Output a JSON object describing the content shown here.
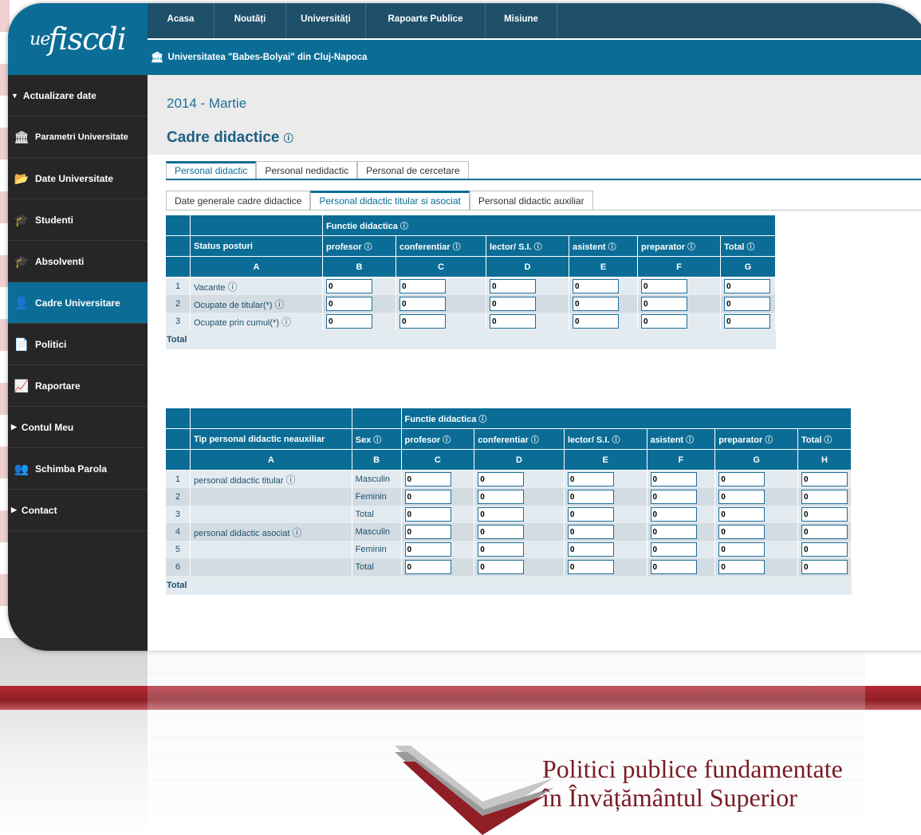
{
  "app": {
    "logo_text": "uefiscdi"
  },
  "top_menu": [
    "Acasa",
    "Noutăți",
    "Universități",
    "Rapoarte Publice",
    "Misiune"
  ],
  "university": "Universitatea \"Babes-Bolyai\" din Cluj-Napoca",
  "sidebar": {
    "items": [
      {
        "label": "Actualizare date",
        "icon": "triangle-down-icon"
      },
      {
        "label": "Parametri Universitate",
        "icon": "institution-icon"
      },
      {
        "label": "Date Universitate",
        "icon": "folder-icon"
      },
      {
        "label": "Studenti",
        "icon": "students-icon"
      },
      {
        "label": "Absolventi",
        "icon": "graduation-cap-icon"
      },
      {
        "label": "Cadre Universitare",
        "icon": "teacher-icon"
      },
      {
        "label": "Politici",
        "icon": "document-icon"
      },
      {
        "label": "Raportare",
        "icon": "chart-icon"
      },
      {
        "label": "Contul Meu",
        "icon": "triangle-right-icon"
      },
      {
        "label": "Schimba Parola",
        "icon": "user-key-icon"
      },
      {
        "label": "Contact",
        "icon": "triangle-right-icon"
      }
    ]
  },
  "period": "2014 - Martie",
  "page_title": "Cadre didactice",
  "tabs_primary": [
    "Personal didactic",
    "Personal nedidactic",
    "Personal de cercetare"
  ],
  "tabs_secondary": [
    "Date generale cadre didactice",
    "Personal didactic titular si asociat",
    "Personal didactic auxiliar"
  ],
  "table1": {
    "group_header": "Functie didactica",
    "row_header": "Status posturi",
    "columns": [
      "profesor",
      "conferentiar",
      "lector/ S.I.",
      "asistent",
      "preparator",
      "Total"
    ],
    "letters": [
      "A",
      "B",
      "C",
      "D",
      "E",
      "F",
      "G"
    ],
    "rows": [
      {
        "num": "1",
        "label": "Vacante",
        "values": [
          "0",
          "0",
          "0",
          "0",
          "0",
          "0"
        ]
      },
      {
        "num": "2",
        "label": "Ocupate de titular(*)",
        "values": [
          "0",
          "0",
          "0",
          "0",
          "0",
          "0"
        ]
      },
      {
        "num": "3",
        "label": "Ocupate prin cumul(*)",
        "values": [
          "0",
          "0",
          "0",
          "0",
          "0",
          "0"
        ]
      }
    ],
    "total_label": "Total"
  },
  "table2": {
    "group_header": "Functie didactica",
    "row_header": "Tip personal didactic neauxiliar",
    "sex_header": "Sex",
    "columns": [
      "profesor",
      "conferentiar",
      "lector/ S.I.",
      "asistent",
      "preparator",
      "Total"
    ],
    "letters": [
      "A",
      "B",
      "C",
      "D",
      "E",
      "F",
      "G",
      "H"
    ],
    "rows": [
      {
        "num": "1",
        "label": "personal didactic titular",
        "sex": "Masculin",
        "values": [
          "0",
          "0",
          "0",
          "0",
          "0",
          "0"
        ]
      },
      {
        "num": "2",
        "label": "",
        "sex": "Feminin",
        "values": [
          "0",
          "0",
          "0",
          "0",
          "0",
          "0"
        ]
      },
      {
        "num": "3",
        "label": "",
        "sex": "Total",
        "values": [
          "0",
          "0",
          "0",
          "0",
          "0",
          "0"
        ]
      },
      {
        "num": "4",
        "label": "personal didactic asociat",
        "sex": "Masculin",
        "values": [
          "0",
          "0",
          "0",
          "0",
          "0",
          "0"
        ]
      },
      {
        "num": "5",
        "label": "",
        "sex": "Feminin",
        "values": [
          "0",
          "0",
          "0",
          "0",
          "0",
          "0"
        ]
      },
      {
        "num": "6",
        "label": "",
        "sex": "Total",
        "values": [
          "0",
          "0",
          "0",
          "0",
          "0",
          "0"
        ]
      }
    ],
    "total_label": "Total"
  },
  "footer": {
    "line1": "Politici publice fundamentate",
    "line2": "în Învățământul Superior"
  },
  "colors": {
    "primary": "#0b6d96",
    "topbar": "#1f506a",
    "sidebar": "#262626",
    "brand_red": "#8f1e26"
  }
}
